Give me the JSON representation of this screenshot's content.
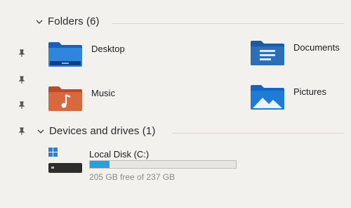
{
  "sections": {
    "folders": {
      "title": "Folders (6)",
      "items": [
        {
          "label": "Desktop",
          "icon": "desktop-folder-icon",
          "pinned": true
        },
        {
          "label": "Documents",
          "icon": "documents-folder-icon",
          "pinned": false
        },
        {
          "label": "Music",
          "icon": "music-folder-icon",
          "pinned": true
        },
        {
          "label": "Pictures",
          "icon": "pictures-folder-icon",
          "pinned": false
        }
      ]
    },
    "drives": {
      "title": "Devices and drives (1)",
      "items": [
        {
          "label": "Local Disk (C:)",
          "icon": "local-disk-icon",
          "free_text": "205 GB free of 237 GB",
          "used_fraction": 0.135
        }
      ]
    }
  },
  "colors": {
    "background": "#f3f1ee",
    "folder_blue": "#1f6fc6",
    "music_orange": "#d46c3b",
    "usage_bar": "#2a9fe0"
  }
}
